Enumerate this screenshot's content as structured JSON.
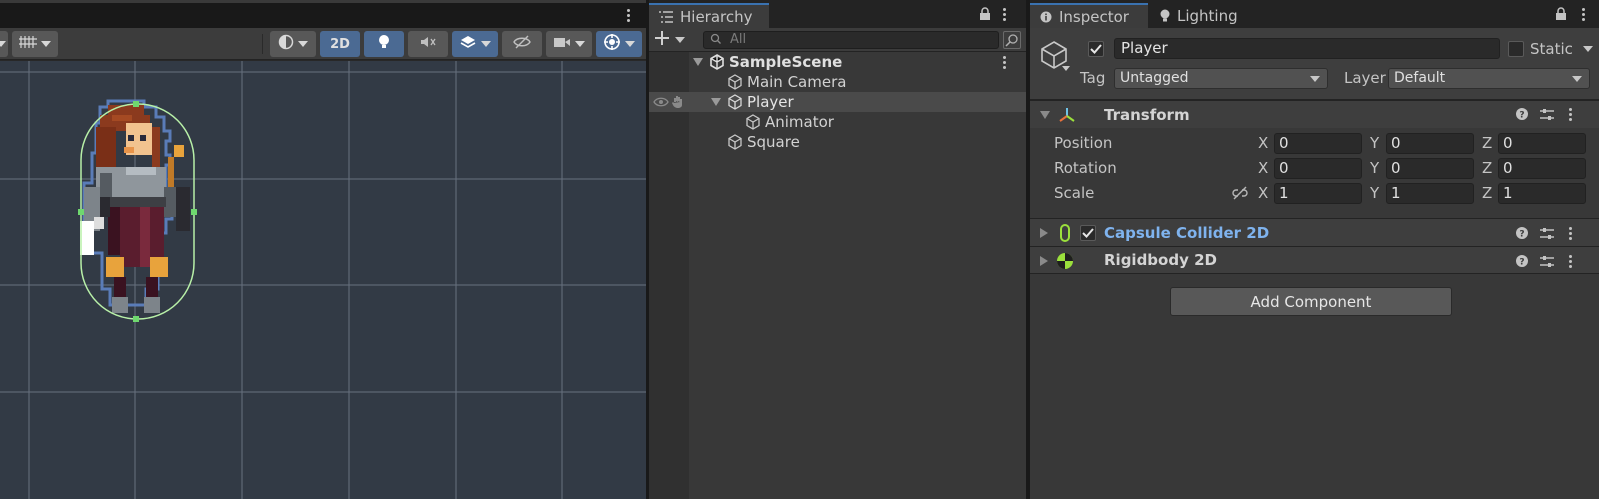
{
  "scene": {
    "toolbar": {
      "btn_2d_label": "2D"
    },
    "colors": {
      "viewport_bg": "#323a45",
      "grid_line": "#7a8494",
      "collider_outline": "#b8f0a8",
      "selection_outline": "#5a7cb8"
    }
  },
  "hierarchy": {
    "tab_label": "Hierarchy",
    "search_placeholder": "All",
    "tree": [
      {
        "label": "SampleScene",
        "depth": 0,
        "expanded": true,
        "type": "scene"
      },
      {
        "label": "Main Camera",
        "depth": 1,
        "type": "gameobject"
      },
      {
        "label": "Player",
        "depth": 1,
        "expanded": true,
        "selected": true,
        "type": "gameobject"
      },
      {
        "label": "Animator",
        "depth": 2,
        "type": "gameobject"
      },
      {
        "label": "Square",
        "depth": 1,
        "type": "gameobject"
      }
    ]
  },
  "inspector": {
    "tab_label": "Inspector",
    "lighting_tab_label": "Lighting",
    "object_name": "Player",
    "active": true,
    "static_label": "Static",
    "static_checked": false,
    "tag_label": "Tag",
    "tag_value": "Untagged",
    "layer_label": "Layer",
    "layer_value": "Default",
    "transform": {
      "title": "Transform",
      "position_label": "Position",
      "rotation_label": "Rotation",
      "scale_label": "Scale",
      "axis_x": "X",
      "axis_y": "Y",
      "axis_z": "Z",
      "position": {
        "x": "0",
        "y": "0",
        "z": "0"
      },
      "rotation": {
        "x": "0",
        "y": "0",
        "z": "0"
      },
      "scale": {
        "x": "1",
        "y": "1",
        "z": "1"
      }
    },
    "capsule_collider": {
      "title": "Capsule Collider 2D",
      "enabled": true
    },
    "rigidbody": {
      "title": "Rigidbody 2D"
    },
    "add_component_label": "Add Component",
    "colors": {
      "accent_tab": "#3a72b0",
      "link_text": "#7fb3ee",
      "collider_icon": "#9be03c"
    }
  }
}
